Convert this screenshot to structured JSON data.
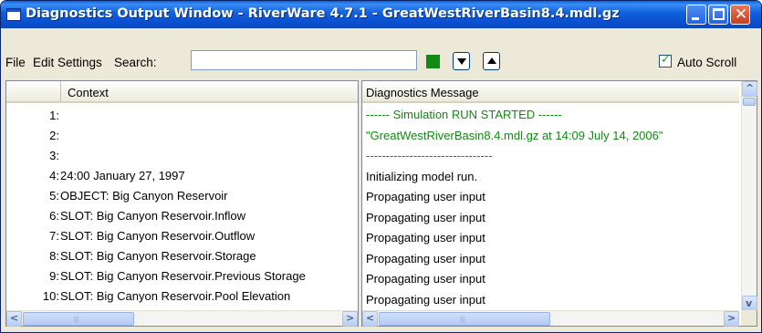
{
  "window": {
    "title": "Diagnostics Output Window - RiverWare 4.7.1 - GreatWestRiverBasin8.4.mdl.gz",
    "title_color": "#0a4fcf"
  },
  "menu": {
    "file": "File",
    "edit": "Edit",
    "settings": "Settings",
    "search_label": "Search:"
  },
  "search": {
    "value": ""
  },
  "status": {
    "color": "#118a11"
  },
  "auto_scroll": {
    "label": "Auto Scroll",
    "checked": true
  },
  "context_pane": {
    "header": "Context",
    "rows": [
      {
        "num": "1:",
        "text": ""
      },
      {
        "num": "2:",
        "text": ""
      },
      {
        "num": "3:",
        "text": ""
      },
      {
        "num": "4:",
        "text": "24:00 January 27, 1997"
      },
      {
        "num": "5:",
        "text": "OBJECT: Big Canyon Reservoir"
      },
      {
        "num": "6:",
        "text": "SLOT: Big Canyon Reservoir.Inflow"
      },
      {
        "num": "7:",
        "text": "SLOT: Big Canyon Reservoir.Outflow"
      },
      {
        "num": "8:",
        "text": "SLOT: Big Canyon Reservoir.Storage"
      },
      {
        "num": "9:",
        "text": "SLOT: Big Canyon Reservoir.Previous Storage"
      },
      {
        "num": "10:",
        "text": "SLOT: Big Canyon Reservoir.Pool Elevation"
      }
    ]
  },
  "message_pane": {
    "header": "Diagnostics Message",
    "rows": [
      {
        "text": "------ Simulation RUN STARTED ------",
        "green": true
      },
      {
        "text": "\"GreatWestRiverBasin8.4.mdl.gz at 14:09 July 14, 2006\"",
        "green": true
      },
      {
        "text": "--------------------------------",
        "green": true
      },
      {
        "text": "Initializing model run.",
        "green": false
      },
      {
        "text": "Propagating user input",
        "green": false
      },
      {
        "text": "Propagating user input",
        "green": false
      },
      {
        "text": "Propagating user input",
        "green": false
      },
      {
        "text": "Propagating user input",
        "green": false
      },
      {
        "text": "Propagating user input",
        "green": false
      },
      {
        "text": "Propagating user input",
        "green": false
      }
    ]
  },
  "icons": {
    "minimize": "minimize-icon",
    "maximize": "maximize-icon",
    "close": "close-icon",
    "next": "triangle-down-icon",
    "previous": "triangle-up-icon"
  }
}
